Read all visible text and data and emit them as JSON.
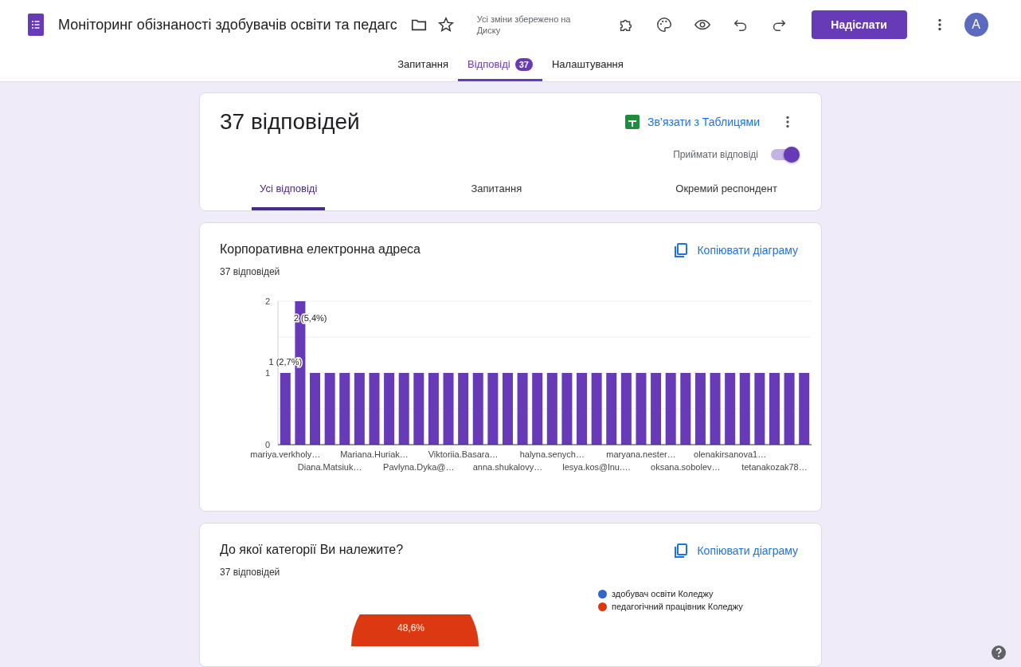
{
  "header": {
    "title": "Моніторинг обізнаності здобувачів освіти та педагс",
    "save_status": "Усі зміни збережено на Диску",
    "send_button": "Надіслати",
    "avatar": "A"
  },
  "tabs": [
    {
      "label": "Запитання",
      "selected": false
    },
    {
      "label": "Відповіді",
      "selected": true,
      "badge": "37"
    },
    {
      "label": "Налаштування",
      "selected": false
    }
  ],
  "summary": {
    "title": "37 відповідей",
    "link_sheets": "Зв’язати з Таблицями",
    "accepting_label": "Приймати відповіді",
    "accepting": true,
    "tabs": [
      {
        "label": "Усі відповіді",
        "selected": true
      },
      {
        "label": "Запитання",
        "selected": false
      },
      {
        "label": "Окремий респондент",
        "selected": false
      }
    ]
  },
  "questions": [
    {
      "title": "Корпоративна електронна адреса",
      "count": "37 відповідей",
      "copy_label": "Копіювати діаграму",
      "chart_data": {
        "type": "bar",
        "yticks": [
          0,
          1,
          2
        ],
        "ylim": [
          0,
          2
        ],
        "categories": [
          "mariya.verkholy…",
          null,
          null,
          "Diana.Matsiuk…",
          null,
          null,
          "Mariana.Huriak…",
          null,
          null,
          "Pavlyna.Dyka@…",
          null,
          null,
          "Viktoriia.Basara…",
          null,
          null,
          "anna.shukalovy…",
          null,
          null,
          "halyna.senych…",
          null,
          null,
          "lesya.kos@lnu.…",
          null,
          null,
          "maryana.nester…",
          null,
          null,
          "oksana.sobolev…",
          null,
          null,
          "olenakirsanova1…",
          null,
          null,
          "tetanakozak78…",
          null,
          null
        ],
        "series": [
          {
            "color": "#673ab7",
            "values": [
              1,
              2,
              1,
              1,
              1,
              1,
              1,
              1,
              1,
              1,
              1,
              1,
              1,
              1,
              1,
              1,
              1,
              1,
              1,
              1,
              1,
              1,
              1,
              1,
              1,
              1,
              1,
              1,
              1,
              1,
              1,
              1,
              1,
              1,
              1,
              1
            ]
          }
        ],
        "value_labels": [
          "1 (2,7%)",
          "2 (5,4%)",
          null,
          null,
          null,
          null,
          null,
          null,
          null,
          null,
          null,
          null,
          null,
          null,
          null,
          null,
          null,
          null,
          null,
          null,
          null,
          null,
          null,
          null,
          null,
          null,
          null,
          null,
          null,
          null,
          null,
          null,
          null,
          null,
          null,
          null
        ]
      }
    },
    {
      "title": "До якої категорії Ви належите?",
      "count": "37 відповідей",
      "copy_label": "Копіювати діаграму",
      "pie_label": "48,6%",
      "legend": [
        {
          "label": "здобувач освіти Коледжу",
          "color": "#3366cc"
        },
        {
          "label": "педагогічний працівник Коледжу",
          "color": "#dc3912"
        }
      ]
    }
  ]
}
